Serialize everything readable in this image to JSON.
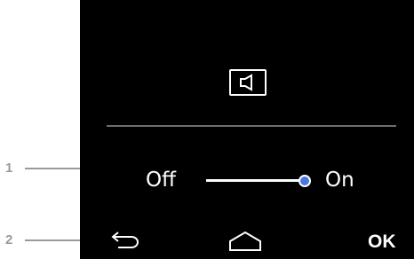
{
  "callouts": [
    {
      "number": "1",
      "target": "on-off-slider"
    },
    {
      "number": "2",
      "target": "back-button"
    }
  ],
  "sound_setting": {
    "icon": "speaker-icon",
    "toggle": {
      "off_label": "Off",
      "on_label": "On",
      "value": "on"
    }
  },
  "navbar": {
    "back_icon": "back-arrow-icon",
    "home_icon": "home-icon",
    "ok_label": "OK"
  },
  "colors": {
    "screen_background": "#000000",
    "slider_knob": "#4a78e0",
    "callout": "#9a9a9a"
  }
}
